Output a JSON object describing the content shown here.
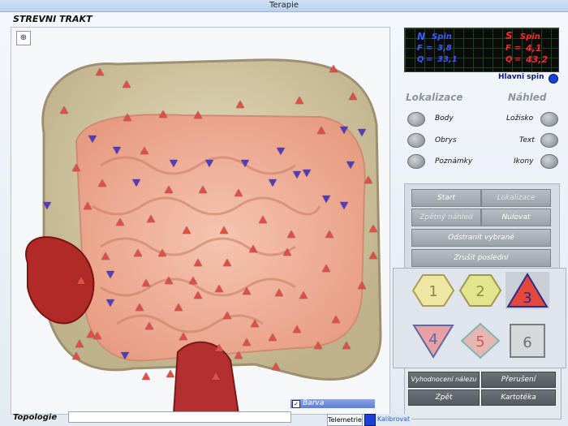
{
  "window": {
    "title": "Terapie"
  },
  "image_panel": {
    "title": "STREVNI TRAKT",
    "zoom_icon": "zoom-in-icon"
  },
  "spin": {
    "n": {
      "letter": "N",
      "label": "Spin",
      "f_label": "F",
      "f_value": "3,8",
      "q_label": "Q",
      "q_value": "33,1"
    },
    "s": {
      "letter": "S",
      "label": "Spin",
      "f_label": "F",
      "f_value": "4,1",
      "q_label": "Q",
      "q_value": "43,2"
    },
    "hlavni_label": "Hlavni spin"
  },
  "lokalizace": {
    "title": "Lokalizace",
    "items": [
      "Body",
      "Obrys",
      "Poznámky"
    ]
  },
  "nahled": {
    "title": "Náhled",
    "items": [
      "Ložisko",
      "Text",
      "Ikony"
    ]
  },
  "actions": {
    "start": "Start",
    "lokalizace": "Lokalizace",
    "zpetny_nahled": "Zpětný náhled",
    "nulovat": "Nulovat",
    "odstranit": "Odstranit vybrané",
    "zrusit": "Zrušit poslední"
  },
  "shapes": [
    "1",
    "2",
    "3",
    "4",
    "5",
    "6"
  ],
  "bottom_actions": {
    "vyhodnoceni": "Vyhodnocení nálezu",
    "preruseni": "Přerušení",
    "zpet": "Zpět",
    "kartoteka": "Kartotéka"
  },
  "barva": {
    "label": "Barva",
    "checked": true
  },
  "topologie": {
    "label": "Topologie",
    "value": ""
  },
  "status": {
    "telemetrie": "Telemetrie",
    "kalibrovat": "Kalibrovat"
  }
}
